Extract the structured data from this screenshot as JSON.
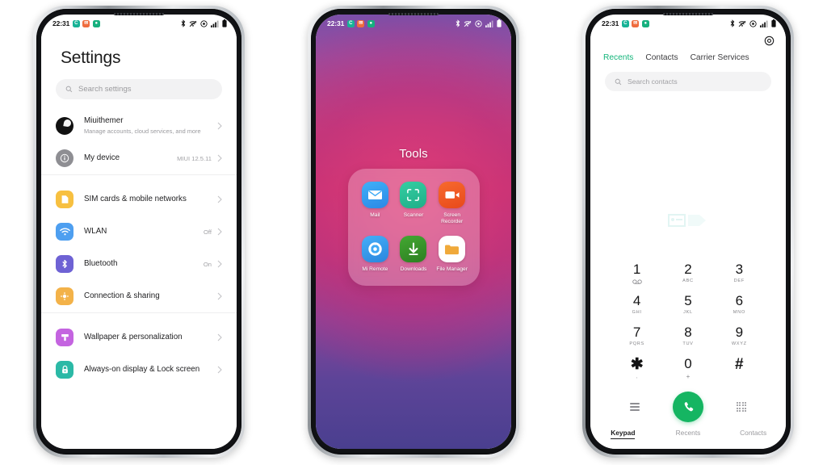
{
  "status_bar": {
    "time": "22:31",
    "badges": [
      {
        "name": "calendar-badge",
        "glyph": "C",
        "color": "#17b396"
      },
      {
        "name": "mail-badge",
        "glyph": "✉",
        "color": "#ef6c3e"
      },
      {
        "name": "android-badge",
        "glyph": "●",
        "color": "#16b07e"
      }
    ],
    "icons": [
      "bluetooth-icon",
      "wifi-off-icon",
      "alarm-icon",
      "signal-icon",
      "battery-icon"
    ]
  },
  "settings": {
    "title": "Settings",
    "search_placeholder": "Search settings",
    "groups": [
      {
        "name": "account-group",
        "rows": [
          {
            "name": "account",
            "title": "Miuithemer",
            "subtitle": "Manage accounts, cloud services, and more",
            "value": "",
            "icon": "avatar-icon",
            "icon_color": "#111111"
          },
          {
            "name": "my-device",
            "title": "My device",
            "subtitle": "",
            "value": "MIUI 12.5.11",
            "icon": "info-icon",
            "icon_color": "#8e8e93"
          }
        ]
      },
      {
        "name": "connectivity-group",
        "rows": [
          {
            "name": "sim-cards",
            "title": "SIM cards & mobile networks",
            "subtitle": "",
            "value": "",
            "icon": "sim-card-icon",
            "icon_color": "#f7c040"
          },
          {
            "name": "wlan",
            "title": "WLAN",
            "subtitle": "",
            "value": "Off",
            "icon": "wifi-icon",
            "icon_color": "#4e9ff0"
          },
          {
            "name": "bluetooth",
            "title": "Bluetooth",
            "subtitle": "",
            "value": "On",
            "icon": "bluetooth-icon",
            "icon_color": "#6e62d4"
          },
          {
            "name": "connection-sharing",
            "title": "Connection & sharing",
            "subtitle": "",
            "value": "",
            "icon": "share-icon",
            "icon_color": "#f3b249"
          }
        ]
      },
      {
        "name": "personalization-group",
        "rows": [
          {
            "name": "wallpaper",
            "title": "Wallpaper & personalization",
            "subtitle": "",
            "value": "",
            "icon": "brush-icon",
            "icon_color": "#c464e0"
          },
          {
            "name": "always-on-display",
            "title": "Always-on display & Lock screen",
            "subtitle": "",
            "value": "",
            "icon": "lock-icon",
            "icon_color": "#2bb9a6"
          }
        ]
      }
    ]
  },
  "home": {
    "folder_title": "Tools",
    "apps": [
      {
        "name": "mail-app",
        "label": "Mail",
        "icon": "mail-icon",
        "color1": "#3aa8f5",
        "color2": "#2d8ce8"
      },
      {
        "name": "scanner-app",
        "label": "Scanner",
        "icon": "scanner-icon",
        "color1": "#2fc49a",
        "color2": "#1fae88"
      },
      {
        "name": "screen-recorder-app",
        "label": "Screen Recorder",
        "icon": "video-camera-icon",
        "color1": "#f4602a",
        "color2": "#e84f1d"
      },
      {
        "name": "mi-remote-app",
        "label": "Mi Remote",
        "icon": "remote-control-icon",
        "color1": "#3fa9f5",
        "color2": "#2f8fe0"
      },
      {
        "name": "downloads-app",
        "label": "Downloads",
        "icon": "download-arrow-icon",
        "color1": "#3d9b2f",
        "color2": "#2f8424"
      },
      {
        "name": "file-manager-app",
        "label": "File Manager",
        "icon": "folder-icon",
        "color1": "#ffffff",
        "color2": "#f4f4f4"
      }
    ]
  },
  "dialer": {
    "settings_icon": "gear-icon",
    "tabs": [
      {
        "name": "tab-recents",
        "label": "Recents",
        "active": true
      },
      {
        "name": "tab-contacts",
        "label": "Contacts",
        "active": false
      },
      {
        "name": "tab-carrier-services",
        "label": "Carrier Services",
        "active": false
      }
    ],
    "search_placeholder": "Search contacts",
    "keys": [
      {
        "digit": "1",
        "sub": "",
        "name": "key-1"
      },
      {
        "digit": "2",
        "sub": "ABC",
        "name": "key-2"
      },
      {
        "digit": "3",
        "sub": "DEF",
        "name": "key-3"
      },
      {
        "digit": "4",
        "sub": "GHI",
        "name": "key-4"
      },
      {
        "digit": "5",
        "sub": "JKL",
        "name": "key-5"
      },
      {
        "digit": "6",
        "sub": "MNO",
        "name": "key-6"
      },
      {
        "digit": "7",
        "sub": "PQRS",
        "name": "key-7"
      },
      {
        "digit": "8",
        "sub": "TUV",
        "name": "key-8"
      },
      {
        "digit": "9",
        "sub": "WXYZ",
        "name": "key-9"
      },
      {
        "digit": "✱",
        "sub": ",",
        "name": "key-star"
      },
      {
        "digit": "0",
        "sub": "+",
        "name": "key-0"
      },
      {
        "digit": "#",
        "sub": "",
        "name": "key-hash"
      }
    ],
    "call_button_color": "#15b562",
    "accent_color": "#13b47a",
    "nav": [
      {
        "name": "nav-keypad",
        "label": "Keypad",
        "active": true
      },
      {
        "name": "nav-recents",
        "label": "Recents",
        "active": false
      },
      {
        "name": "nav-contacts",
        "label": "Contacts",
        "active": false
      }
    ]
  }
}
